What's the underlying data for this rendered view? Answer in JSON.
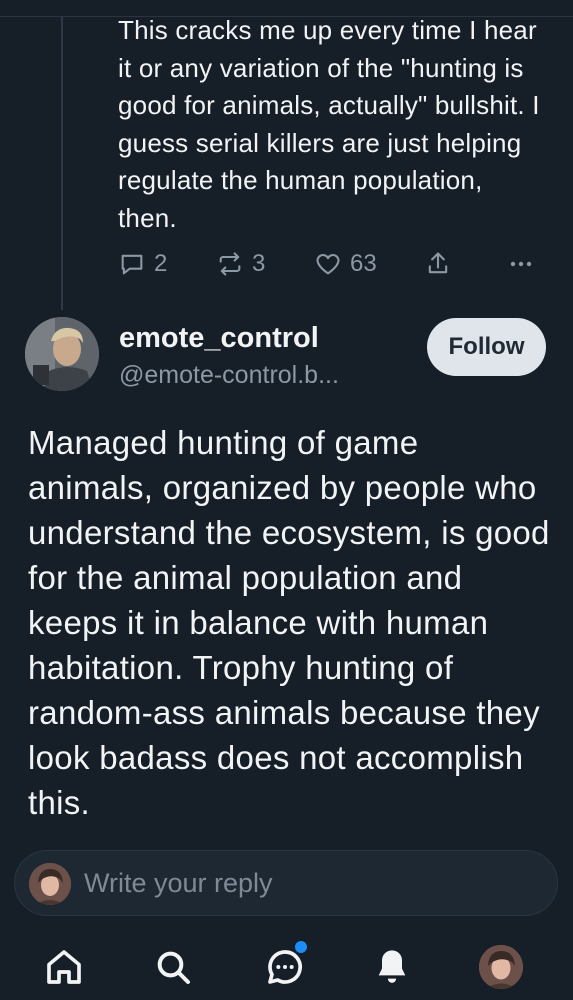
{
  "parent_post": {
    "text": "This cracks me up every time I hear it or any variation of the \"hunting is good for animals, actually\" bullshit. I guess serial killers are just helping regulate the human population, then.",
    "reply_count": "2",
    "repost_count": "3",
    "like_count": "63"
  },
  "post": {
    "author_name": "emote_control",
    "author_handle": "@emote-control.b...",
    "follow_label": "Follow",
    "text": "Managed hunting of game animals, organized by people who understand the ecosystem, is good for the animal population and keeps it in balance with human habitation. Trophy hunting of random-ass animals because they look badass does not accomplish this."
  },
  "reply_bar": {
    "placeholder": "Write your reply"
  },
  "colors": {
    "background": "#161e27",
    "text_primary": "#f1f3f5",
    "text_secondary": "#8b98a5",
    "notification_dot": "#1d8cf5"
  },
  "nav": {
    "items": [
      "home-icon",
      "search-icon",
      "chat-icon",
      "bell-icon",
      "profile-avatar"
    ],
    "chat_has_notification": true
  }
}
